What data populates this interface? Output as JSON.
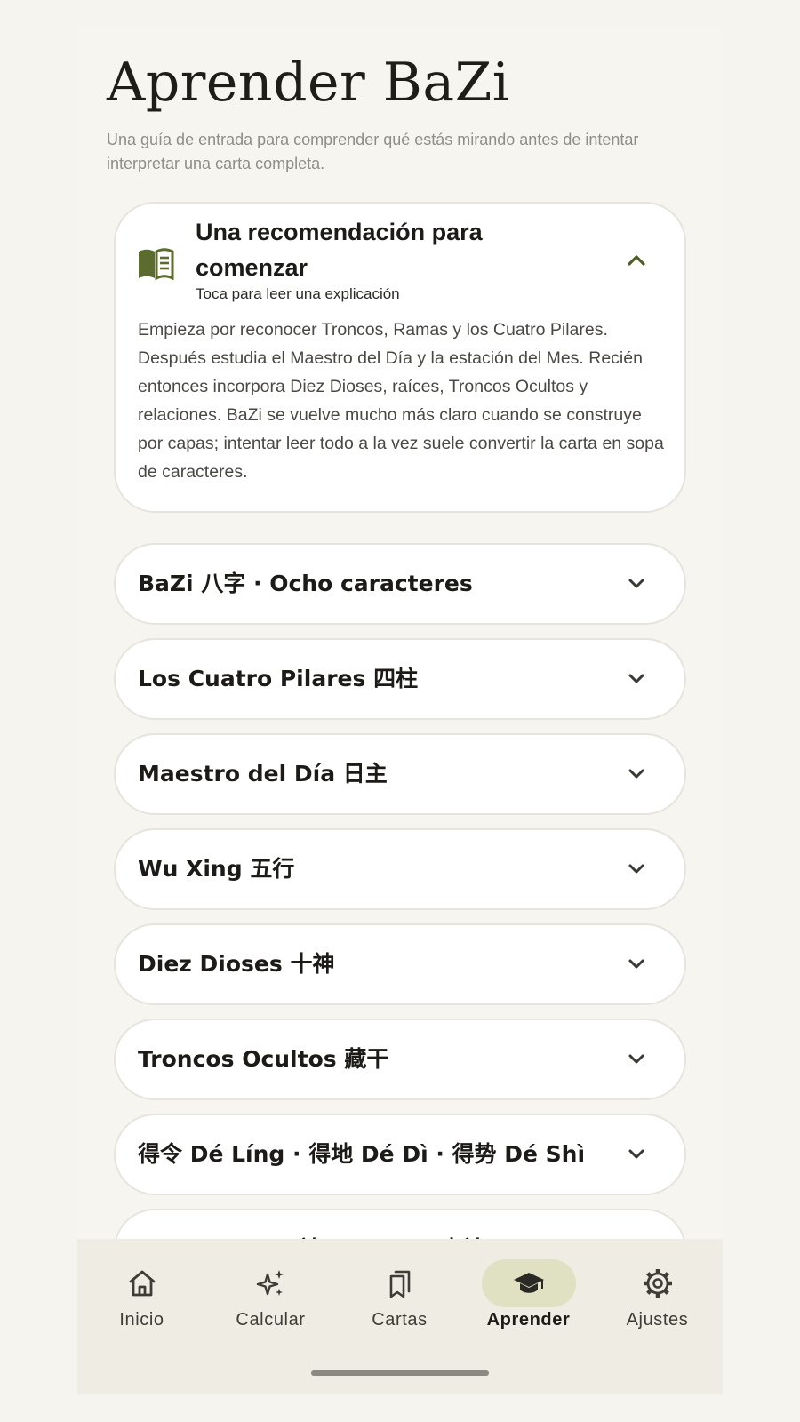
{
  "header": {
    "title": "Aprender BaZi",
    "subtitle": "Una guía de entrada para comprender qué estás mirando antes de intentar interpretar una carta completa."
  },
  "recommendation": {
    "icon": "book-open-icon",
    "title": "Una recomendación para comenzar",
    "hint": "Toca para leer una explicación",
    "expanded": true,
    "body": "Empieza por reconocer Troncos, Ramas y los Cuatro Pilares. Después estudia el Maestro del Día y la estación del Mes. Recién entonces incorpora Diez Dioses, raíces, Troncos Ocultos y relaciones. BaZi se vuelve mucho más claro cuando se construye por capas; intentar leer todo a la vez suele convertir la carta en sopa de caracteres."
  },
  "topics": [
    {
      "label": "BaZi 八字 · Ocho caracteres"
    },
    {
      "label": "Los Cuatro Pilares 四柱"
    },
    {
      "label": "Maestro del Día 日主"
    },
    {
      "label": "Wu Xing 五行"
    },
    {
      "label": "Diez Dioses 十神"
    },
    {
      "label": "Troncos Ocultos 藏干"
    },
    {
      "label": "得令 Dé Líng · 得地 Dé Dì · 得势 Dé Shì"
    },
    {
      "label": "Yong Shen 用神, Xi Shen 喜神 y Ji Shen"
    }
  ],
  "nav": {
    "items": [
      {
        "label": "Inicio",
        "icon": "home-icon",
        "active": false
      },
      {
        "label": "Calcular",
        "icon": "sparkle-icon",
        "active": false
      },
      {
        "label": "Cartas",
        "icon": "bookmarks-icon",
        "active": false
      },
      {
        "label": "Aprender",
        "icon": "graduation-cap-icon",
        "active": true
      },
      {
        "label": "Ajustes",
        "icon": "gear-icon",
        "active": false
      }
    ]
  },
  "colors": {
    "background": "#f6f5f0",
    "accent": "#5c6b2e",
    "active_pill": "#dfe1c2",
    "nav_background": "#efede3"
  }
}
